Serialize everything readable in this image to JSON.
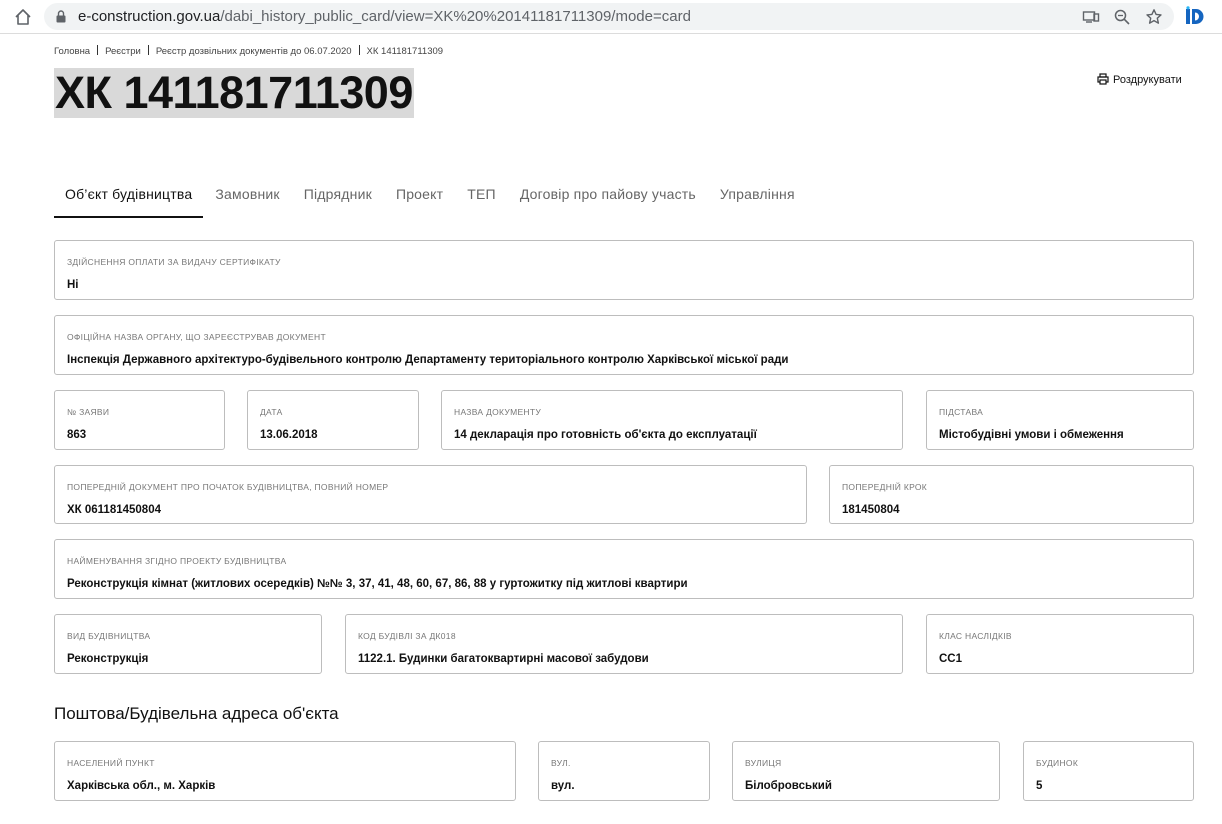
{
  "browser": {
    "url_host": "e-construction.gov.ua",
    "url_path": "/dabi_history_public_card/view=XK%20%20141181711309/mode=card"
  },
  "breadcrumb": [
    "Головна",
    "Реєстри",
    "Реєстр дозвільних документів до 06.07.2020",
    "ХК 141181711309"
  ],
  "title": "ХК 141181711309",
  "print_label": "Роздрукувати",
  "tabs": [
    "Об’єкт будівництва",
    "Замовник",
    "Підрядник",
    "Проект",
    "ТЕП",
    "Договір про пайову участь",
    "Управління"
  ],
  "fields": {
    "payment": {
      "label": "Здійснення оплати за видачу сертифікату",
      "value": "Ні"
    },
    "authority": {
      "label": "Офіційна назва органу, що зареєстрував документ",
      "value": "Інспекція Державного архітектуро-будівельного контролю Департаменту територіального контролю Харківської міської ради"
    },
    "application_no": {
      "label": "№ заяви",
      "value": "863"
    },
    "date": {
      "label": "Дата",
      "value": "13.06.2018"
    },
    "doc_name": {
      "label": "Назва документу",
      "value": "14 декларація про готовність об'єкта до експлуатації"
    },
    "basis": {
      "label": "Підстава",
      "value": "Містобудівні умови і обмеження"
    },
    "prev_doc": {
      "label": "Попередній документ про початок будівництва, повний номер",
      "value": "ХК 061181450804"
    },
    "prev_step": {
      "label": "Попередній крок",
      "value": "181450804"
    },
    "project_name": {
      "label": "Найменування згідно проекту будівництва",
      "value": "Реконструкція кімнат (житлових осередків) №№ 3, 37, 41, 48, 60, 67, 86, 88 у гуртожитку під житлові квартири"
    },
    "construction_type": {
      "label": "Вид будівництва",
      "value": "Реконструкція"
    },
    "building_code": {
      "label": "Код будівлі за ДК018",
      "value": "1122.1. Будинки багатоквартирні масової забудови"
    },
    "consequence_class": {
      "label": "Клас наслідків",
      "value": "СС1"
    }
  },
  "address_section_title": "Поштова/Будівельна адреса об'єкта",
  "address": {
    "locality": {
      "label": "Населений пункт",
      "value": "Харківська обл., м. Харків"
    },
    "street_type": {
      "label": "Вул.",
      "value": "вул."
    },
    "street": {
      "label": "Вулиця",
      "value": "Білобровський"
    },
    "house": {
      "label": "Будинок",
      "value": "5"
    }
  }
}
